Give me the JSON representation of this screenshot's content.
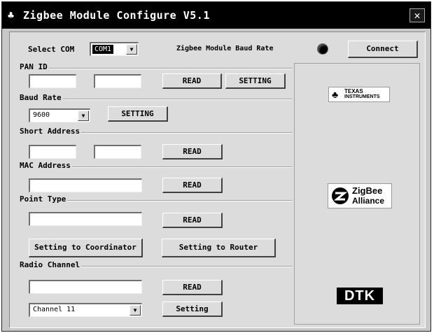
{
  "window": {
    "title": "Zigbee Module Configure V5.1",
    "close_glyph": "✕"
  },
  "top": {
    "select_com_label": "Select COM",
    "com_value": "COM1",
    "baud_label": "Zigbee Module Baud Rate",
    "connect_label": "Connect"
  },
  "pan_id": {
    "title": "PAN ID",
    "field1": "",
    "field2": "",
    "read_label": "READ",
    "setting_label": "SETTING"
  },
  "baud_rate": {
    "title": "Baud Rate",
    "value": "9600",
    "setting_label": "SETTING"
  },
  "short_address": {
    "title": "Short Address",
    "field1": "",
    "field2": "",
    "read_label": "READ"
  },
  "mac_address": {
    "title": "MAC Address",
    "field": "",
    "read_label": "READ"
  },
  "point_type": {
    "title": "Point Type",
    "field": "",
    "read_label": "READ",
    "coordinator_label": "Setting to Coordinator",
    "router_label": "Setting to Router"
  },
  "radio_channel": {
    "title": "Radio Channel",
    "field": "",
    "read_label": "READ",
    "channel_value": "Channel 11",
    "setting_label": "Setting"
  },
  "logos": {
    "ti_line1": "TEXAS",
    "ti_line2": "INSTRUMENTS",
    "zigbee_line1": "ZigBee",
    "zigbee_line2": "Alliance",
    "dtk": "DTK"
  }
}
